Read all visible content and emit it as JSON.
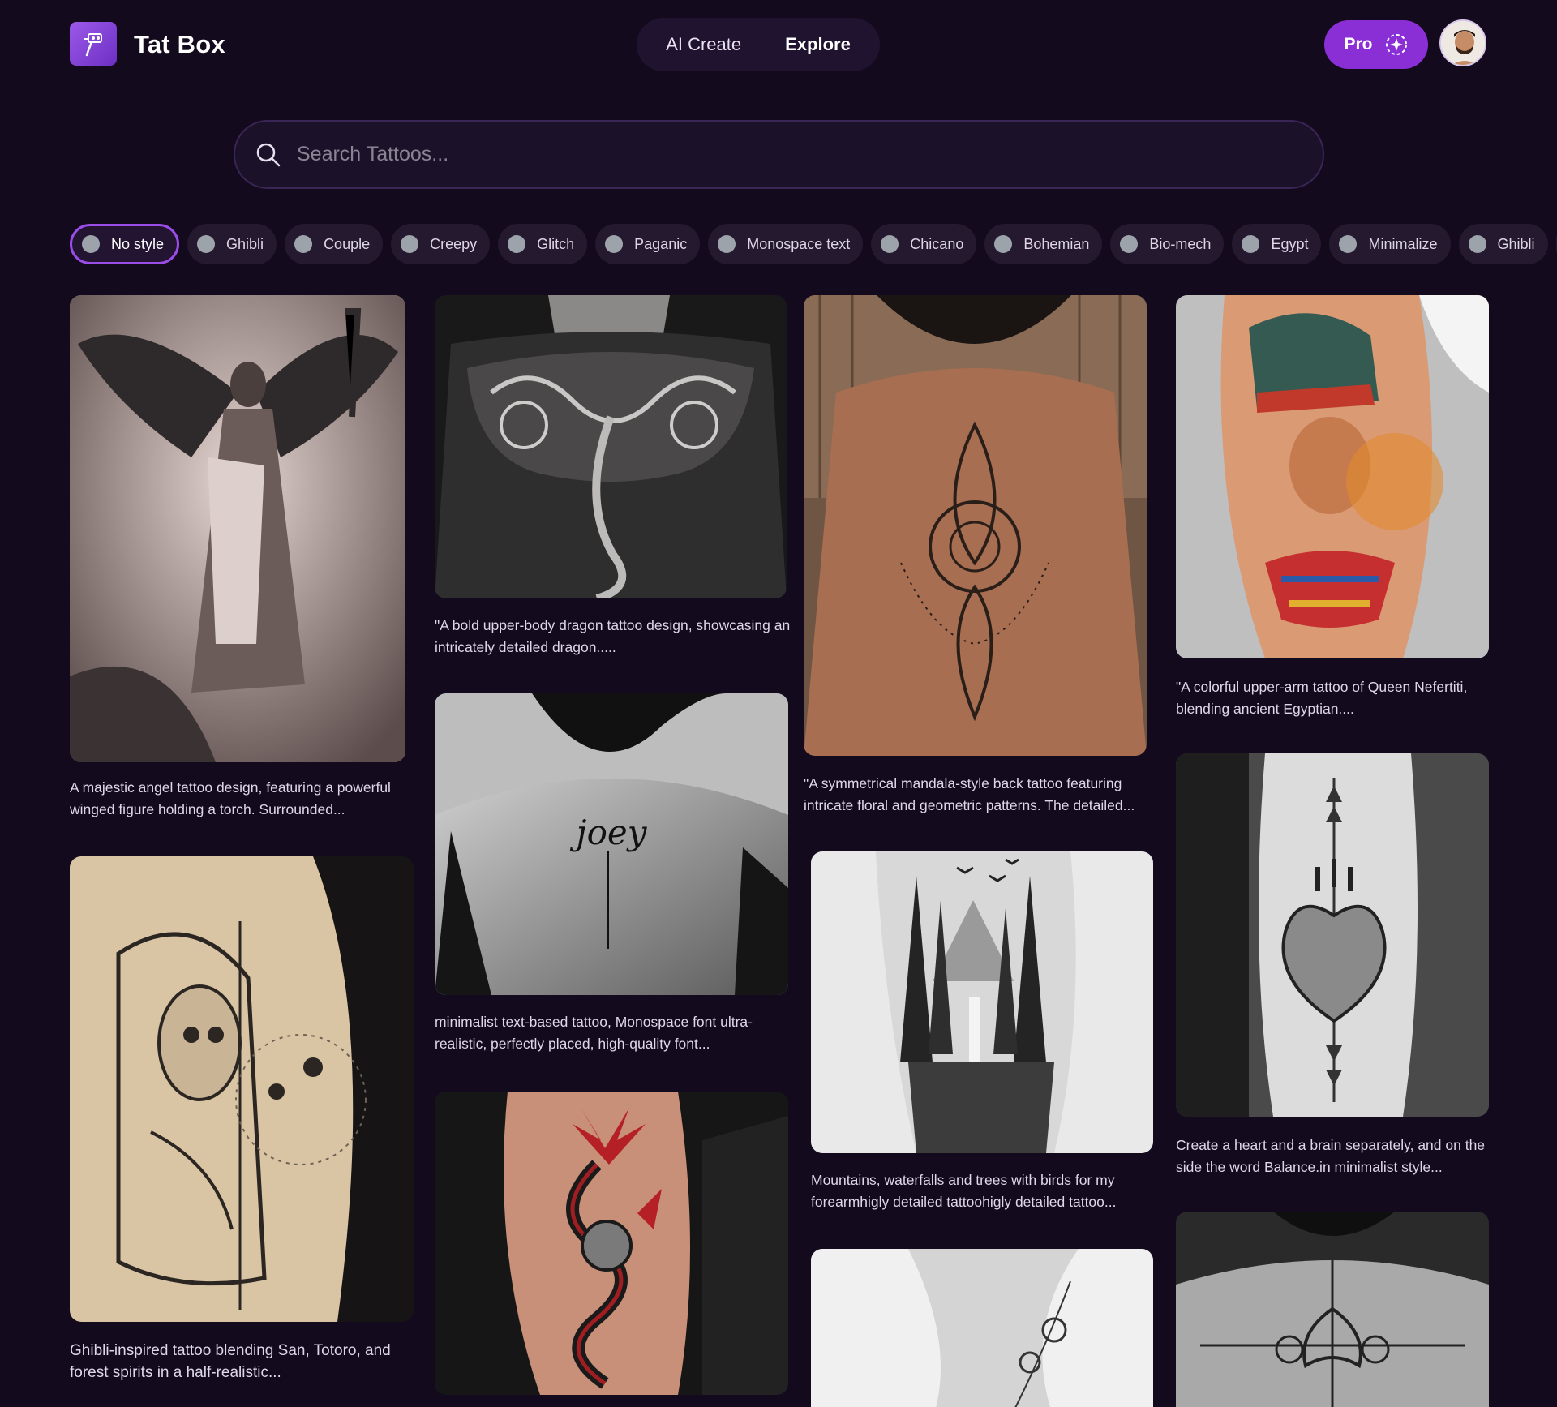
{
  "header": {
    "brand": "Tat Box",
    "nav": [
      "AI Create",
      "Explore"
    ],
    "pro_label": "Pro",
    "accent": "#8a2fd6"
  },
  "search": {
    "placeholder": "Search Tattoos..."
  },
  "filters": [
    "No style",
    "Ghibli",
    "Couple",
    "Creepy",
    "Glitch",
    "Paganic",
    "Monospace text",
    "Chicano",
    "Bohemian",
    "Bio-mech",
    "Egypt",
    "Minimalize",
    "Ghibli"
  ],
  "active_filter": "No style",
  "cards": [
    {
      "caption": "A majestic angel tattoo design, featuring a powerful winged figure holding a torch. Surrounded..."
    },
    {
      "caption": "Ghibli-inspired tattoo blending San, Totoro, and forest spirits in a half-realistic..."
    },
    {
      "caption": "\"A bold upper-body dragon tattoo design, showcasing an intricately detailed dragon....."
    },
    {
      "caption": "minimalist text-based tattoo, Monospace font ultra-realistic, perfectly placed, high-quality font..."
    },
    {
      "caption": ""
    },
    {
      "caption": "\"A symmetrical mandala-style back tattoo featuring intricate floral and geometric patterns. The detailed..."
    },
    {
      "caption": "Mountains, waterfalls and trees with birds for my forearmhigly detailed tattoohigly detailed tattoo..."
    },
    {
      "caption": ""
    },
    {
      "caption": "\"A colorful upper-arm tattoo of Queen Nefertiti, blending ancient Egyptian...."
    },
    {
      "caption": "Create a heart and a brain separately, and on the side the word Balance.in minimalist style..."
    },
    {
      "caption": ""
    }
  ],
  "tattoo_text": "joey"
}
